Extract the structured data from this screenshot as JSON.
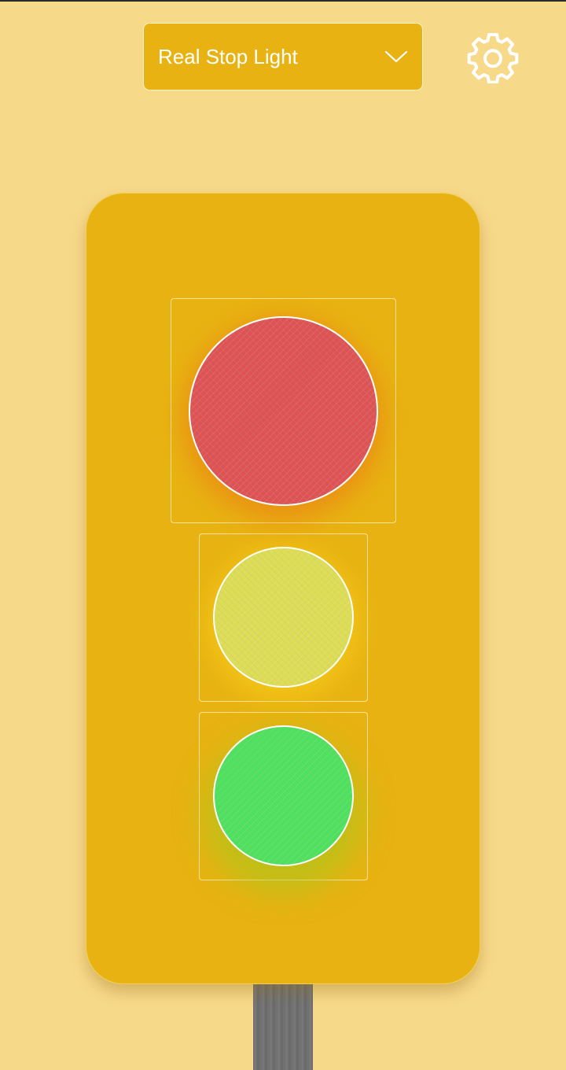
{
  "theme": {
    "background": "#f7d98a",
    "accent": "#e8b312",
    "border": "#fff3c8",
    "red_lamp": "#dd5253",
    "yellow_lamp": "#dcdc55",
    "green_lamp": "#4fe05d"
  },
  "header": {
    "mode_select": {
      "selected": "Real Stop Light",
      "icon": "chevron-down-icon"
    },
    "settings": {
      "icon": "gear-icon"
    }
  },
  "traffic_light": {
    "lamps": [
      {
        "name": "red",
        "color": "#dd5253"
      },
      {
        "name": "yellow",
        "color": "#dcdc55"
      },
      {
        "name": "green",
        "color": "#4fe05d"
      }
    ]
  }
}
